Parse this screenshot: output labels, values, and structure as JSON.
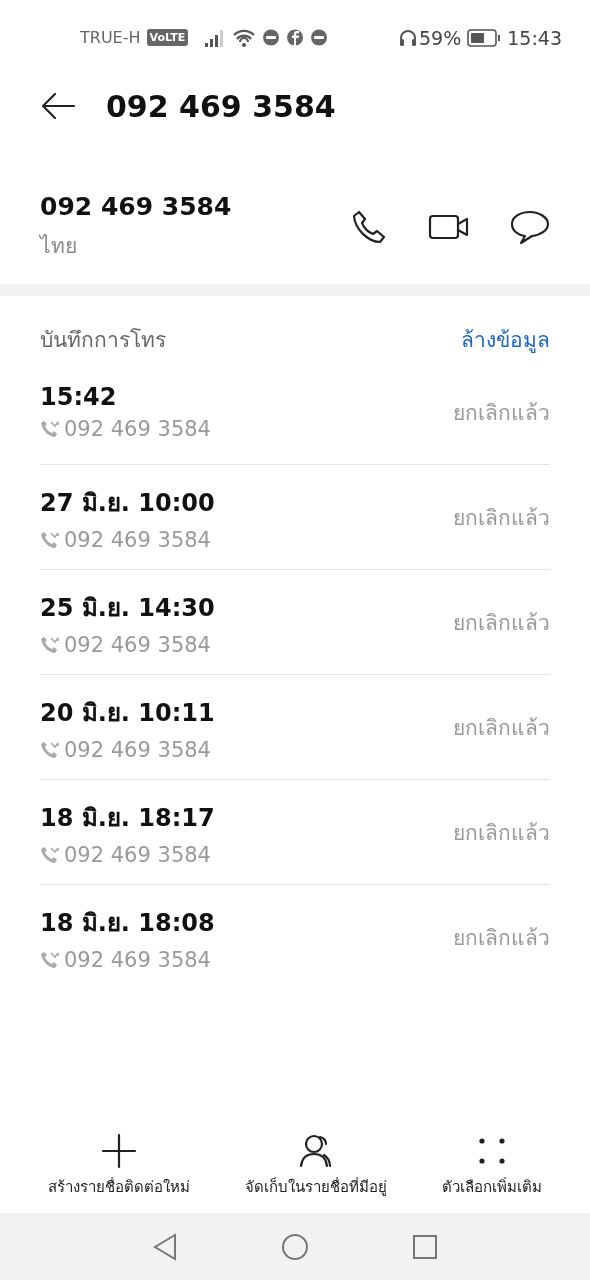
{
  "status_bar": {
    "carrier": "TRUE-H",
    "network_badge": "VoLTE",
    "battery_percent": "59%",
    "time": "15:43"
  },
  "header": {
    "title": "092 469 3584"
  },
  "contact": {
    "number": "092 469 3584",
    "location": "ไทย"
  },
  "call_log": {
    "title": "บันทึกการโทร",
    "clear_link": "ล้างข้อมูล",
    "entries": [
      {
        "time": "15:42",
        "number": "092 469 3584",
        "status": "ยกเลิกแล้ว"
      },
      {
        "time": "27 มิ.ย. 10:00",
        "number": "092 469 3584",
        "status": "ยกเลิกแล้ว"
      },
      {
        "time": "25 มิ.ย. 14:30",
        "number": "092 469 3584",
        "status": "ยกเลิกแล้ว"
      },
      {
        "time": "20 มิ.ย. 10:11",
        "number": "092 469 3584",
        "status": "ยกเลิกแล้ว"
      },
      {
        "time": "18 มิ.ย. 18:17",
        "number": "092 469 3584",
        "status": "ยกเลิกแล้ว"
      },
      {
        "time": "18 มิ.ย. 18:08",
        "number": "092 469 3584",
        "status": "ยกเลิกแล้ว"
      }
    ]
  },
  "bottom_actions": [
    {
      "kind": "add",
      "label": "สร้างรายชื่อติดต่อใหม่"
    },
    {
      "kind": "person",
      "label": "จัดเก็บในรายชื่อที่มีอยู่"
    },
    {
      "kind": "more",
      "label": "ตัวเลือกเพิ่มเติม"
    }
  ]
}
